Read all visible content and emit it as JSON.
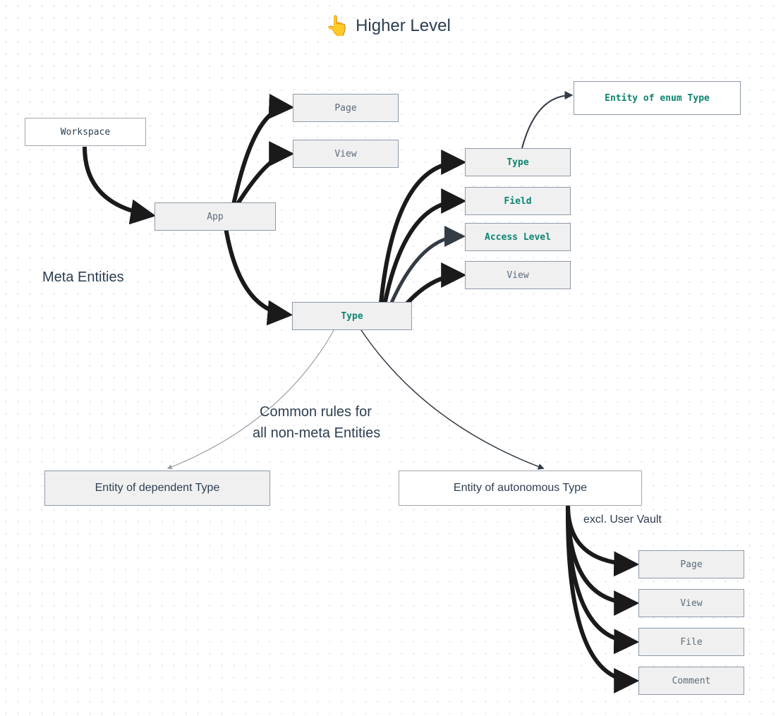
{
  "title": "Higher Level",
  "emoji": "👆",
  "labels": {
    "meta": "Meta Entities",
    "common1": "Common rules for",
    "common2": "all non-meta Entities",
    "excl": "excl. User Vault"
  },
  "nodes": {
    "workspace": "Workspace",
    "app": "App",
    "page1": "Page",
    "view1": "View",
    "type_center": "Type",
    "type_right": "Type",
    "field": "Field",
    "access": "Access Level",
    "view2": "View",
    "enum_entity": "Entity of enum Type",
    "dep_entity": "Entity of dependent Type",
    "auto_entity": "Entity of autonomous Type",
    "page2": "Page",
    "view3": "View",
    "file": "File",
    "comment": "Comment"
  }
}
